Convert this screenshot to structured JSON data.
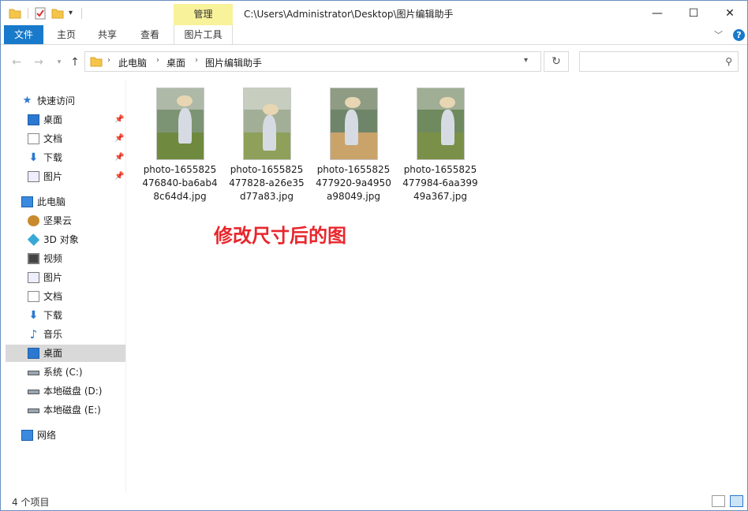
{
  "window": {
    "title_path": "C:\\Users\\Administrator\\Desktop\\图片编辑助手",
    "manage_tab": "管理",
    "controls": {
      "minimize": "—",
      "maximize": "☐",
      "close": "✕"
    }
  },
  "ribbon": {
    "tabs": [
      "文件",
      "主页",
      "共享",
      "查看",
      "图片工具"
    ],
    "help": "?"
  },
  "nav": {
    "breadcrumb": [
      "此电脑",
      "桌面",
      "图片编辑助手"
    ],
    "search_placeholder": ""
  },
  "sidebar": {
    "quick_access": "快速访问",
    "pinned": [
      {
        "label": "桌面",
        "icon": "desktop-icon"
      },
      {
        "label": "文档",
        "icon": "document-icon"
      },
      {
        "label": "下载",
        "icon": "download-icon"
      },
      {
        "label": "图片",
        "icon": "picture-icon"
      }
    ],
    "this_pc": "此电脑",
    "pc_items": [
      {
        "label": "坚果云",
        "icon": "nutstore-icon"
      },
      {
        "label": "3D 对象",
        "icon": "3d-objects-icon"
      },
      {
        "label": "视频",
        "icon": "video-icon"
      },
      {
        "label": "图片",
        "icon": "picture-icon"
      },
      {
        "label": "文档",
        "icon": "document-icon"
      },
      {
        "label": "下载",
        "icon": "download-icon"
      },
      {
        "label": "音乐",
        "icon": "music-icon"
      },
      {
        "label": "桌面",
        "icon": "desktop-icon",
        "selected": true
      },
      {
        "label": "系统 (C:)",
        "icon": "drive-icon"
      },
      {
        "label": "本地磁盘 (D:)",
        "icon": "drive-icon"
      },
      {
        "label": "本地磁盘 (E:)",
        "icon": "drive-icon"
      }
    ],
    "network": "网络"
  },
  "files": [
    {
      "name": "photo-1655825476840-ba6ab48c64d4.jpg",
      "line1": "photo-1655825",
      "line2": "476840-ba6ab4",
      "line3": "8c64d4.jpg"
    },
    {
      "name": "photo-1655825477828-a26e35d77a83.jpg",
      "line1": "photo-1655825",
      "line2": "477828-a26e35",
      "line3": "d77a83.jpg"
    },
    {
      "name": "photo-1655825477920-9a4950a98049.jpg",
      "line1": "photo-1655825",
      "line2": "477920-9a4950",
      "line3": "a98049.jpg"
    },
    {
      "name": "photo-1655825477984-6aa39949a367.jpg",
      "line1": "photo-1655825",
      "line2": "477984-6aa399",
      "line3": "49a367.jpg"
    }
  ],
  "overlay_text": "修改尺寸后的图",
  "status": {
    "count": "4 个项目"
  }
}
